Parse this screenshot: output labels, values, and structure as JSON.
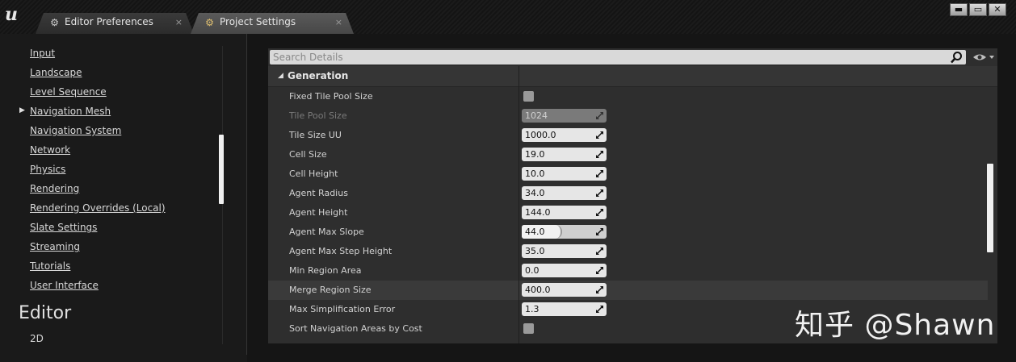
{
  "tabs": [
    {
      "label": "Editor Preferences",
      "close": "×"
    },
    {
      "label": "Project Settings",
      "close": "×"
    }
  ],
  "window_buttons": {
    "minimize": "▬",
    "maximize": "▭",
    "close": "✕"
  },
  "sidebar": {
    "items": [
      "Input",
      "Landscape",
      "Level Sequence",
      "Navigation Mesh",
      "Navigation System",
      "Network",
      "Physics",
      "Rendering",
      "Rendering Overrides (Local)",
      "Slate Settings",
      "Streaming",
      "Tutorials",
      "User Interface"
    ],
    "section": "Editor",
    "next_item": "2D"
  },
  "details": {
    "search_placeholder": "Search Details",
    "category": "Generation",
    "rows": [
      {
        "label": "Fixed Tile Pool Size",
        "type": "checkbox",
        "checked": false
      },
      {
        "label": "Tile Pool Size",
        "type": "number",
        "value": "1024",
        "disabled": true
      },
      {
        "label": "Tile Size UU",
        "type": "number",
        "value": "1000.0"
      },
      {
        "label": "Cell Size",
        "type": "number",
        "value": "19.0"
      },
      {
        "label": "Cell Height",
        "type": "number",
        "value": "10.0"
      },
      {
        "label": "Agent Radius",
        "type": "number",
        "value": "34.0"
      },
      {
        "label": "Agent Height",
        "type": "number",
        "value": "144.0"
      },
      {
        "label": "Agent Max Slope",
        "type": "slider",
        "value": "44.0"
      },
      {
        "label": "Agent Max Step Height",
        "type": "number",
        "value": "35.0"
      },
      {
        "label": "Min Region Area",
        "type": "number",
        "value": "0.0"
      },
      {
        "label": "Merge Region Size",
        "type": "number",
        "value": "400.0",
        "highlighted": true
      },
      {
        "label": "Max Simplification Error",
        "type": "number",
        "value": "1.3"
      },
      {
        "label": "Sort Navigation Areas by Cost",
        "type": "checkbox",
        "checked": false
      }
    ]
  },
  "watermark": "知乎 @Shawn"
}
